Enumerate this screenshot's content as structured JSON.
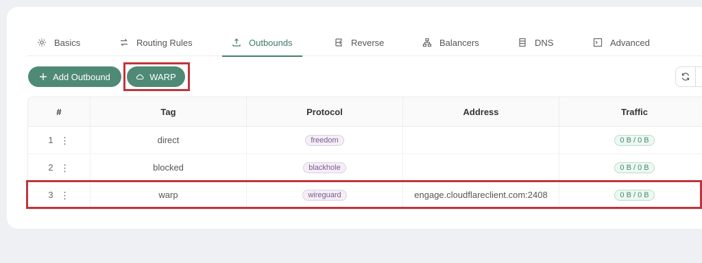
{
  "tabs": [
    {
      "label": "Basics",
      "icon": "gear-icon"
    },
    {
      "label": "Routing Rules",
      "icon": "swap-icon"
    },
    {
      "label": "Outbounds",
      "icon": "upload-icon"
    },
    {
      "label": "Reverse",
      "icon": "return-icon"
    },
    {
      "label": "Balancers",
      "icon": "cluster-icon"
    },
    {
      "label": "DNS",
      "icon": "database-icon"
    },
    {
      "label": "Advanced",
      "icon": "code-icon"
    }
  ],
  "active_tab": "Outbounds",
  "toolbar": {
    "add_outbound_label": "Add Outbound",
    "warp_label": "WARP"
  },
  "table": {
    "headers": [
      "#",
      "Tag",
      "Protocol",
      "Address",
      "Traffic"
    ],
    "rows": [
      {
        "index": "1",
        "tag": "direct",
        "protocol": "freedom",
        "address": "",
        "traffic": "0 B / 0 B"
      },
      {
        "index": "2",
        "tag": "blocked",
        "protocol": "blackhole",
        "address": "",
        "traffic": "0 B / 0 B"
      },
      {
        "index": "3",
        "tag": "warp",
        "protocol": "wireguard",
        "address": "engage.cloudflareclient.com:2408",
        "traffic": "0 B / 0 B"
      }
    ]
  },
  "colors": {
    "accent": "#4f8a76",
    "highlight": "#c0343a",
    "background": "#eff0f3"
  }
}
